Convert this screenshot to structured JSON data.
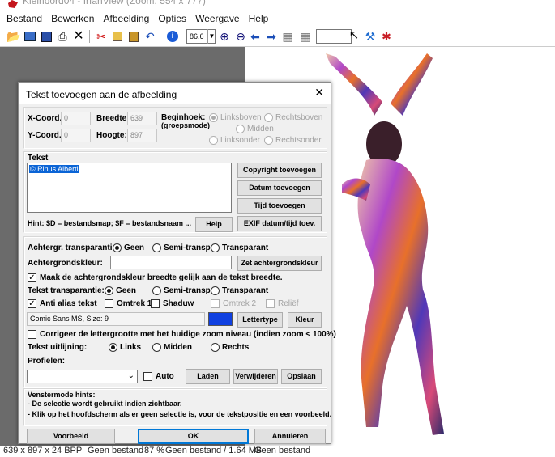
{
  "window": {
    "title": "Kleinbord04 - IrfanView (Zoom: 554 x 777)"
  },
  "menu": [
    "Bestand",
    "Bewerken",
    "Afbeelding",
    "Opties",
    "Weergave",
    "Help"
  ],
  "toolbar": {
    "zoom_value": "86.6"
  },
  "status": {
    "dims": "639 x 897 x 24 BPP",
    "file1": "Geen bestand",
    "zoom": "87 %",
    "file_size": "Geen bestand / 1.64 MB",
    "file2": "Geen bestand"
  },
  "dialog": {
    "title": "Tekst toevoegen aan de afbeelding",
    "coords": {
      "x_label": "X-Coord.:",
      "x_value": "0",
      "y_label": "Y-Coord.:",
      "y_value": "0",
      "width_label": "Breedte:",
      "width_value": "639",
      "height_label": "Hoogte:",
      "height_value": "897",
      "corner_label_1": "Beginhoek:",
      "corner_label_2": "(groepsmode)",
      "opt_top_left": "Linksboven",
      "opt_top_right": "Rechtsboven",
      "opt_middle": "Midden",
      "opt_bottom_left": "Linksonder",
      "opt_bottom_right": "Rechtsonder"
    },
    "text": {
      "label": "Tekst",
      "value": "© Rinus Alberti",
      "hint": "Hint: $D = bestandsmap; $F = bestandsnaam ...",
      "help_button": "Help",
      "copyright_button": "Copyright toevoegen",
      "date_button": "Datum toevoegen",
      "time_button": "Tijd toevoegen",
      "exif_button": "EXIF datum/tijd toev."
    },
    "background": {
      "transparency_label": "Achtergr. transparantie:",
      "opt_none": "Geen",
      "opt_semi": "Semi-transp.",
      "opt_transparent": "Transparant",
      "color_label": "Achtergrondskleur:",
      "set_color_button": "Zet achtergrondskleur",
      "same_width_label": "Maak de achtergrondskleur breedte gelijk aan de tekst breedte."
    },
    "text_style": {
      "transparency_label": "Tekst transparantie:",
      "opt_none": "Geen",
      "opt_semi": "Semi-transp.",
      "opt_transparent": "Transparant",
      "antialias_label": "Anti alias tekst",
      "outline1_label": "Omtrek 1",
      "shadow_label": "Shaduw",
      "outline2_label": "Omtrek 2",
      "relief_label": "Reliëf",
      "font_value": "Comic Sans MS, Size: 9",
      "font_color": "#1040e0",
      "font_button": "Lettertype",
      "color_button": "Kleur",
      "correct_size_label": "Corrigeer de lettergrootte met het huidige zoom niveau (indien zoom < 100%)",
      "align_label": "Tekst uitlijning:",
      "opt_left": "Links",
      "opt_middle": "Midden",
      "opt_right": "Rechts"
    },
    "profiles": {
      "label": "Profielen:",
      "auto_label": "Auto",
      "load_button": "Laden",
      "delete_button": "Verwijderen",
      "save_button": "Opslaan"
    },
    "hints": {
      "title": "Venstermode hints:",
      "line1": "- De selectie wordt gebruikt indien zichtbaar.",
      "line2": "- Klik op het hoofdscherm als er geen selectie is, voor de tekstpositie en een voorbeeld."
    },
    "footer": {
      "preview_button": "Voorbeeld",
      "ok_button": "OK",
      "cancel_button": "Annuleren"
    }
  }
}
